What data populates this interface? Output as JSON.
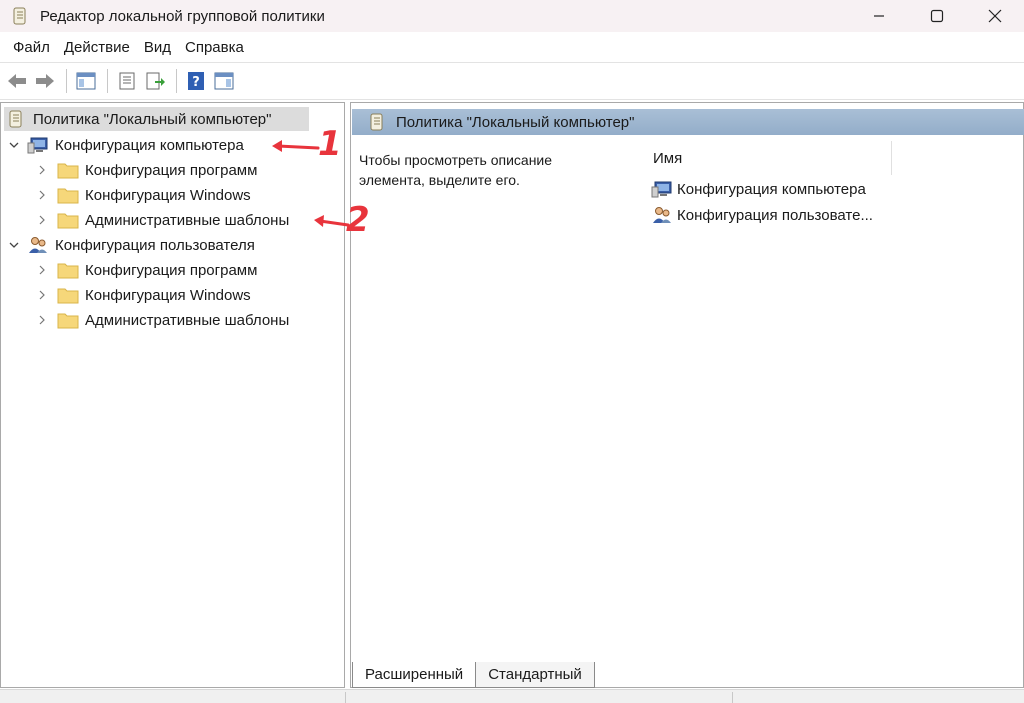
{
  "window": {
    "title": "Редактор локальной групповой политики",
    "controls": [
      "minimize-icon",
      "maximize-icon",
      "close-icon"
    ]
  },
  "menu": [
    "Файл",
    "Действие",
    "Вид",
    "Справка"
  ],
  "toolbar": {
    "buttons": [
      "back-icon",
      "forward-icon",
      "show-hide-tree-icon",
      "properties-icon",
      "export-list-icon",
      "help-icon",
      "show-hide-action-pane-icon"
    ]
  },
  "tree": {
    "root": "Политика \"Локальный компьютер\"",
    "computer": {
      "label": "Конфигурация компьютера",
      "children": [
        "Конфигурация программ",
        "Конфигурация Windows",
        "Административные шаблоны"
      ]
    },
    "user": {
      "label": "Конфигурация пользователя",
      "children": [
        "Конфигурация программ",
        "Конфигурация Windows",
        "Административные шаблоны"
      ]
    }
  },
  "details": {
    "header": "Политика \"Локальный компьютер\"",
    "description": "Чтобы просмотреть описание элемента, выделите его.",
    "column": "Имя",
    "items": [
      "Конфигурация компьютера",
      "Конфигурация пользовате..."
    ]
  },
  "tabs": [
    "Расширенный",
    "Стандартный"
  ],
  "annotations": [
    "1",
    "2"
  ],
  "colors": {
    "annotation": "#e8343c",
    "header_gradient": "#a9bfd6",
    "selection": "#dcdcdc",
    "folder": "#f6d77a"
  }
}
